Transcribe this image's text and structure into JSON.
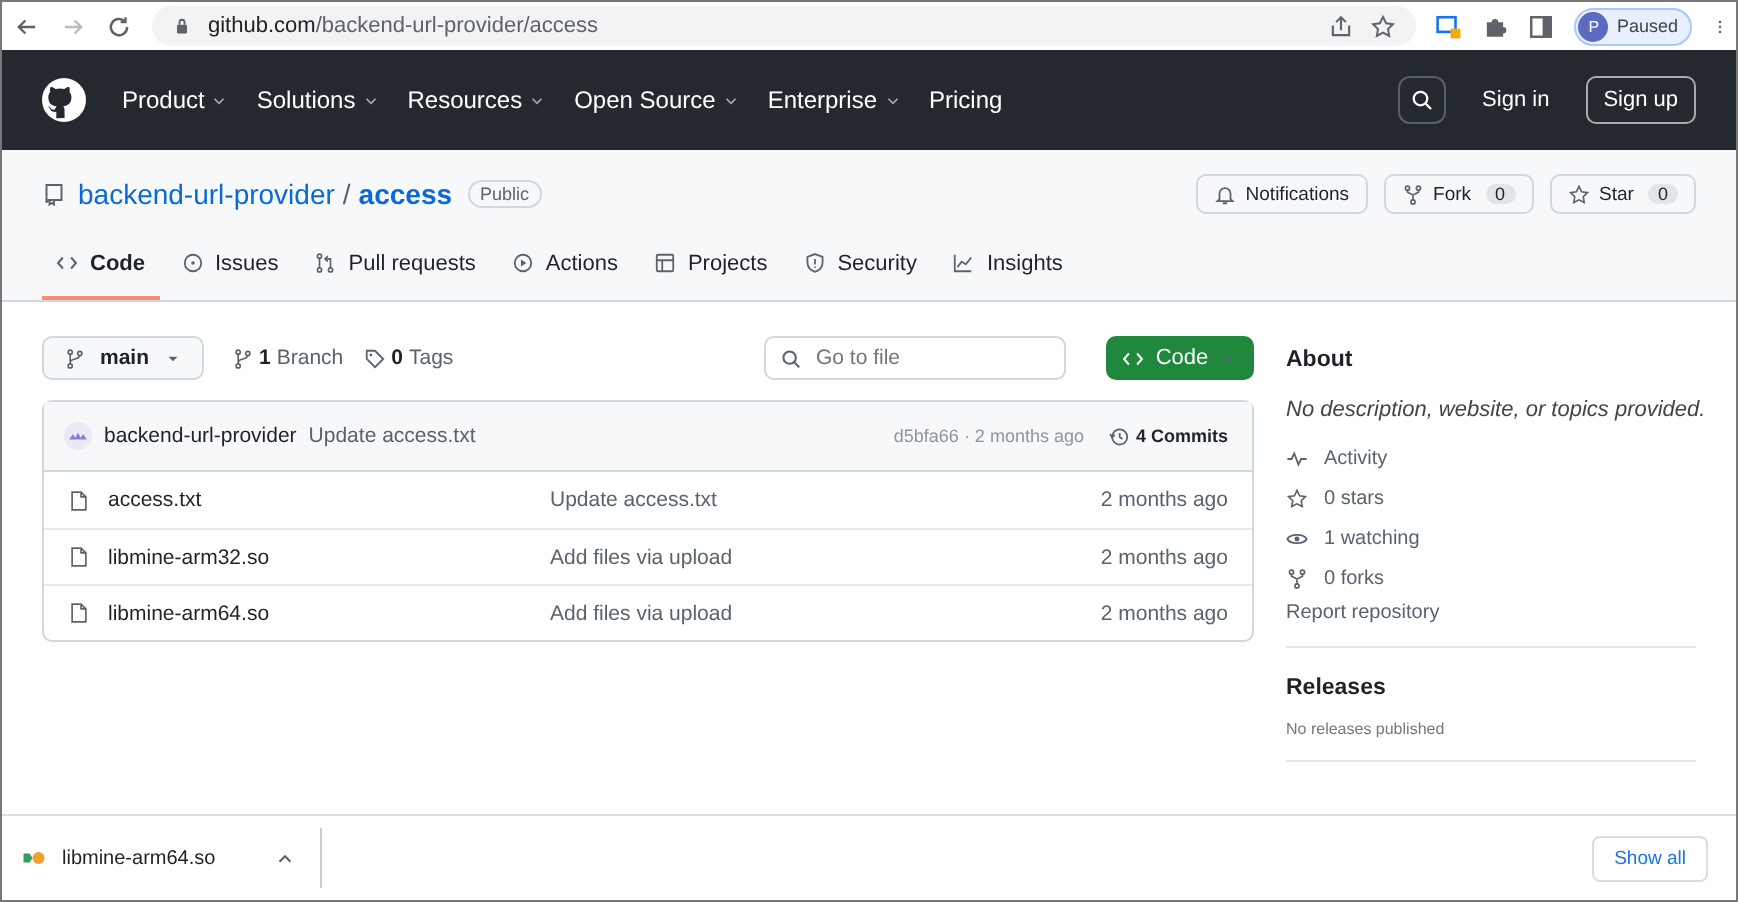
{
  "browser": {
    "url_host": "github.com",
    "url_path": "/backend-url-provider/access",
    "profile": "P",
    "profile_status": "Paused"
  },
  "nav": {
    "items": [
      {
        "label": "Product",
        "dropdown": true
      },
      {
        "label": "Solutions",
        "dropdown": true
      },
      {
        "label": "Resources",
        "dropdown": true
      },
      {
        "label": "Open Source",
        "dropdown": true
      },
      {
        "label": "Enterprise",
        "dropdown": true
      },
      {
        "label": "Pricing",
        "dropdown": false
      }
    ],
    "sign_in": "Sign in",
    "sign_up": "Sign up"
  },
  "repo": {
    "owner": "backend-url-provider",
    "separator": "/",
    "name": "access",
    "visibility": "Public",
    "actions": [
      {
        "label": "Notifications",
        "kind": "bell"
      },
      {
        "label": "Fork",
        "count": "0",
        "kind": "fork"
      },
      {
        "label": "Star",
        "count": "0",
        "kind": "star"
      }
    ]
  },
  "tabs": [
    {
      "label": "Code",
      "kind": "code",
      "selected": true
    },
    {
      "label": "Issues",
      "kind": "issues",
      "selected": false
    },
    {
      "label": "Pull requests",
      "kind": "pulls",
      "selected": false
    },
    {
      "label": "Actions",
      "kind": "actions",
      "selected": false
    },
    {
      "label": "Projects",
      "kind": "projects",
      "selected": false
    },
    {
      "label": "Security",
      "kind": "security",
      "selected": false
    },
    {
      "label": "Insights",
      "kind": "insights",
      "selected": false
    }
  ],
  "toolbar": {
    "branch": "main",
    "branches": "1 Branch",
    "tags": "0 Tags",
    "search_placeholder": "Go to file",
    "code_button": "Code"
  },
  "commit": {
    "author": "backend-url-provider",
    "message": "Update access.txt",
    "meta": "d5bfa66 · 2 months ago",
    "commits": "4 Commits"
  },
  "files": [
    {
      "name": "access.txt",
      "message": "Update access.txt",
      "time": "2 months ago"
    },
    {
      "name": "libmine-arm32.so",
      "message": "Add files via upload",
      "time": "2 months ago"
    },
    {
      "name": "libmine-arm64.so",
      "message": "Add files via upload",
      "time": "2 months ago"
    }
  ],
  "about": {
    "title": "About",
    "description": "No description, website, or topics provided.",
    "items": [
      {
        "label": "Activity",
        "kind": "activity"
      },
      {
        "label": "0 stars",
        "kind": "stars"
      },
      {
        "label": "1 watching",
        "kind": "watchers"
      },
      {
        "label": "0 forks",
        "kind": "forks"
      }
    ],
    "report": "Report repository"
  },
  "releases": {
    "title": "Releases",
    "note": "No releases published"
  },
  "download_bar": {
    "file": "libmine-arm64.so",
    "show_all": "Show all"
  }
}
